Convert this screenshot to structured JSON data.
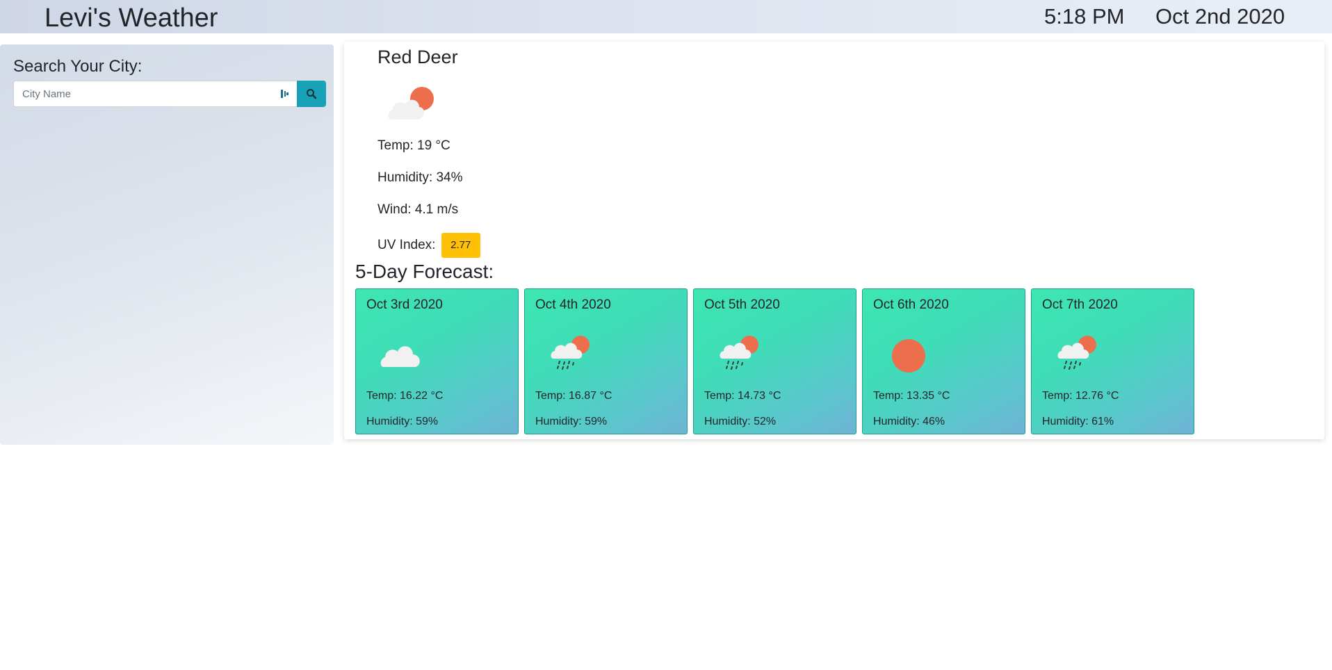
{
  "header": {
    "title": "Levi's Weather",
    "time": "5:18 PM",
    "date": "Oct 2nd 2020"
  },
  "sidebar": {
    "heading": "Search Your City:",
    "search_placeholder": "City Name",
    "search_icon": "search-icon"
  },
  "current": {
    "city": "Red Deer",
    "icon": "partly-cloudy-icon",
    "temp": "Temp: 19 °C",
    "humidity": "Humidity: 34%",
    "wind": "Wind: 4.1 m/s",
    "uv_label": "UV Index:",
    "uv_value": "2.77",
    "uv_color": "#ffc107"
  },
  "forecast": {
    "heading": "5-Day Forecast:",
    "days": [
      {
        "date": "Oct 3rd 2020",
        "icon": "cloud-icon",
        "temp": "Temp: 16.22 °C",
        "humidity": "Humidity: 59%"
      },
      {
        "date": "Oct 4th 2020",
        "icon": "rain-sun-icon",
        "temp": "Temp: 16.87 °C",
        "humidity": "Humidity: 59%"
      },
      {
        "date": "Oct 5th 2020",
        "icon": "rain-sun-icon",
        "temp": "Temp: 14.73 °C",
        "humidity": "Humidity: 52%"
      },
      {
        "date": "Oct 6th 2020",
        "icon": "sun-icon",
        "temp": "Temp: 13.35 °C",
        "humidity": "Humidity: 46%"
      },
      {
        "date": "Oct 7th 2020",
        "icon": "rain-sun-icon",
        "temp": "Temp: 12.76 °C",
        "humidity": "Humidity: 61%"
      }
    ]
  },
  "colors": {
    "accent": "#17a2b8",
    "sun": "#ec6e4c",
    "cloud": "#f1f1f1",
    "card_gradient_start": "#3ee6b0",
    "card_gradient_end": "#6fb3d6"
  }
}
